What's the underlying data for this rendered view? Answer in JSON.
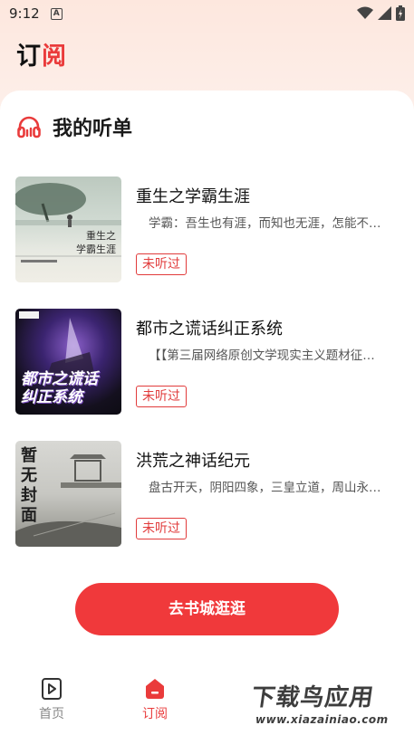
{
  "status_bar": {
    "time": "9:12",
    "notification_letter": "A"
  },
  "header": {
    "title_part1": "订",
    "title_part2": "阅"
  },
  "section": {
    "title": "我的听单",
    "icon": "headphones-icon"
  },
  "books": [
    {
      "title": "重生之学霸生涯",
      "description": "学霸：吾生也有涯，而知也无涯，怎能不…",
      "tag": "未听过",
      "cover_text": "重生之 学霸生涯"
    },
    {
      "title": "都市之谎话纠正系统",
      "description": "【【第三届网络原创文学现实主义题材征…",
      "tag": "未听过",
      "cover_text": "都市之谎话 纠正系统"
    },
    {
      "title": "洪荒之神话纪元",
      "description": "盘古开天，阴阳四象，三皇立道，周山永…",
      "tag": "未听过",
      "cover_text": "暂无封面"
    }
  ],
  "cta": {
    "label": "去书城逛逛"
  },
  "nav": {
    "items": [
      {
        "label": "首页",
        "icon": "play-book-icon"
      },
      {
        "label": "订阅",
        "icon": "subscribe-icon"
      }
    ]
  },
  "watermark": {
    "text": "下载鸟应用",
    "url": "www.xiazainiao.com"
  },
  "colors": {
    "accent": "#f0393b",
    "header_bg": "#fde7de"
  }
}
